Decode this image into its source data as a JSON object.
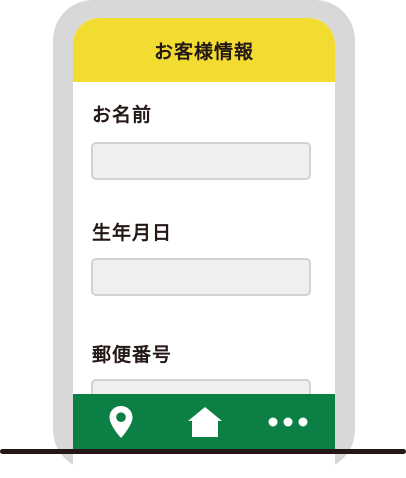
{
  "header": {
    "title": "お客様情報"
  },
  "form": {
    "fields": [
      {
        "label": "お名前",
        "value": ""
      },
      {
        "label": "生年月日",
        "value": ""
      },
      {
        "label": "郵便番号",
        "value": ""
      }
    ]
  },
  "tabbar": {
    "items": [
      {
        "icon": "location-pin-icon"
      },
      {
        "icon": "home-icon"
      },
      {
        "icon": "more-icon"
      }
    ]
  },
  "colors": {
    "header_bg": "#f2dc32",
    "tabbar_bg": "#0b7f44",
    "phone_frame": "#d8d8d8",
    "text": "#231815"
  }
}
